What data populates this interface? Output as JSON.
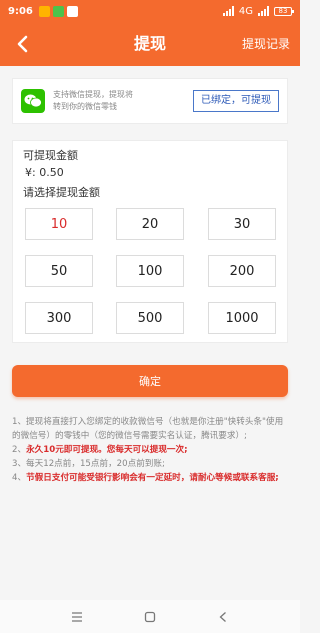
{
  "status_bar": {
    "time": "9:06",
    "network": "4G",
    "battery": "83",
    "app_icon_colors": [
      "#ffb400",
      "#4cc24c",
      "#ffffff"
    ]
  },
  "header": {
    "title": "提现",
    "right_link": "提现记录",
    "back_icon": "chevron-left-icon"
  },
  "wechat": {
    "icon": "wechat-icon",
    "line1": "支持微信提现，提现将",
    "line2": "转到你的微信零钱",
    "bound_label": "已绑定，可提现"
  },
  "amount": {
    "label": "可提现金额",
    "balance": "¥: 0.50",
    "choose_label": "请选择提现金额",
    "options": [
      "10",
      "20",
      "30",
      "50",
      "100",
      "200",
      "300",
      "500",
      "1000"
    ],
    "selected": "10"
  },
  "confirm_label": "确定",
  "notes": {
    "n1": "1、提现将直接打入您绑定的收款微信号（也就是你注册\"快转头条\"使用的微信号）的零钱中（您的微信号需要实名认证，腾讯要求）;",
    "n2_prefix": "2、",
    "n2": "永久10元即可提现。您每天可以提现一次;",
    "n3": "3、每天12点前，15点前，20点前到账;",
    "n4_prefix": "4、",
    "n4": "节假日支付可能受银行影响会有一定延时，请耐心等候或联系客服;"
  },
  "colors": {
    "brand": "#f46a2e",
    "accent_red": "#d92b2b",
    "link_blue": "#2e5bb8",
    "wechat_green": "#2dc100"
  }
}
